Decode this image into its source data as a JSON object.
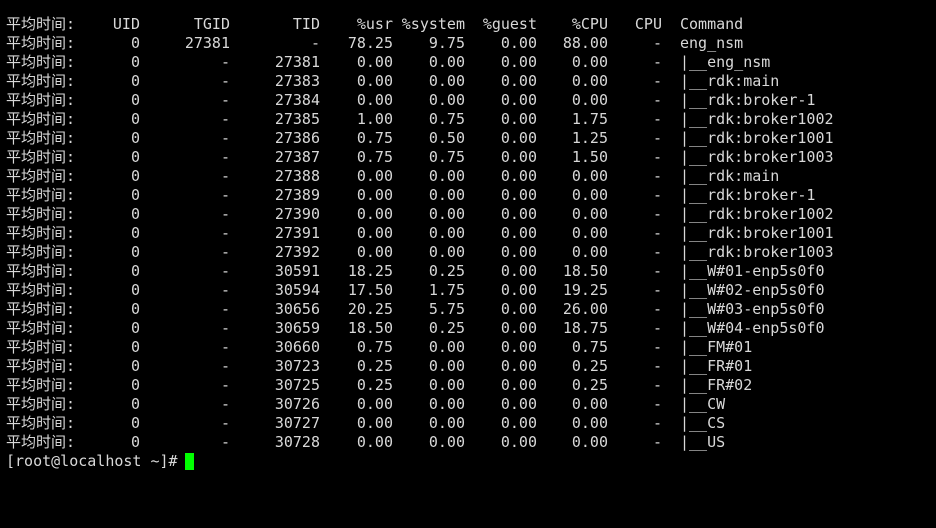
{
  "terminal": {
    "header": {
      "label": "平均时间:",
      "uid": "UID",
      "tgid": "TGID",
      "tid": "TID",
      "usr": "%usr",
      "system": "%system",
      "guest": "%guest",
      "cpu_pct": "%CPU",
      "cpu": "CPU",
      "command": "Command"
    },
    "rows": [
      {
        "label": "平均时间:",
        "uid": "0",
        "tgid": "27381",
        "tid": "-",
        "usr": "78.25",
        "system": "9.75",
        "guest": "0.00",
        "cpu_pct": "88.00",
        "cpu": "-",
        "command": "eng_nsm"
      },
      {
        "label": "平均时间:",
        "uid": "0",
        "tgid": "-",
        "tid": "27381",
        "usr": "0.00",
        "system": "0.00",
        "guest": "0.00",
        "cpu_pct": "0.00",
        "cpu": "-",
        "command": "|__eng_nsm"
      },
      {
        "label": "平均时间:",
        "uid": "0",
        "tgid": "-",
        "tid": "27383",
        "usr": "0.00",
        "system": "0.00",
        "guest": "0.00",
        "cpu_pct": "0.00",
        "cpu": "-",
        "command": "|__rdk:main"
      },
      {
        "label": "平均时间:",
        "uid": "0",
        "tgid": "-",
        "tid": "27384",
        "usr": "0.00",
        "system": "0.00",
        "guest": "0.00",
        "cpu_pct": "0.00",
        "cpu": "-",
        "command": "|__rdk:broker-1"
      },
      {
        "label": "平均时间:",
        "uid": "0",
        "tgid": "-",
        "tid": "27385",
        "usr": "1.00",
        "system": "0.75",
        "guest": "0.00",
        "cpu_pct": "1.75",
        "cpu": "-",
        "command": "|__rdk:broker1002"
      },
      {
        "label": "平均时间:",
        "uid": "0",
        "tgid": "-",
        "tid": "27386",
        "usr": "0.75",
        "system": "0.50",
        "guest": "0.00",
        "cpu_pct": "1.25",
        "cpu": "-",
        "command": "|__rdk:broker1001"
      },
      {
        "label": "平均时间:",
        "uid": "0",
        "tgid": "-",
        "tid": "27387",
        "usr": "0.75",
        "system": "0.75",
        "guest": "0.00",
        "cpu_pct": "1.50",
        "cpu": "-",
        "command": "|__rdk:broker1003"
      },
      {
        "label": "平均时间:",
        "uid": "0",
        "tgid": "-",
        "tid": "27388",
        "usr": "0.00",
        "system": "0.00",
        "guest": "0.00",
        "cpu_pct": "0.00",
        "cpu": "-",
        "command": "|__rdk:main"
      },
      {
        "label": "平均时间:",
        "uid": "0",
        "tgid": "-",
        "tid": "27389",
        "usr": "0.00",
        "system": "0.00",
        "guest": "0.00",
        "cpu_pct": "0.00",
        "cpu": "-",
        "command": "|__rdk:broker-1"
      },
      {
        "label": "平均时间:",
        "uid": "0",
        "tgid": "-",
        "tid": "27390",
        "usr": "0.00",
        "system": "0.00",
        "guest": "0.00",
        "cpu_pct": "0.00",
        "cpu": "-",
        "command": "|__rdk:broker1002"
      },
      {
        "label": "平均时间:",
        "uid": "0",
        "tgid": "-",
        "tid": "27391",
        "usr": "0.00",
        "system": "0.00",
        "guest": "0.00",
        "cpu_pct": "0.00",
        "cpu": "-",
        "command": "|__rdk:broker1001"
      },
      {
        "label": "平均时间:",
        "uid": "0",
        "tgid": "-",
        "tid": "27392",
        "usr": "0.00",
        "system": "0.00",
        "guest": "0.00",
        "cpu_pct": "0.00",
        "cpu": "-",
        "command": "|__rdk:broker1003"
      },
      {
        "label": "平均时间:",
        "uid": "0",
        "tgid": "-",
        "tid": "30591",
        "usr": "18.25",
        "system": "0.25",
        "guest": "0.00",
        "cpu_pct": "18.50",
        "cpu": "-",
        "command": "|__W#01-enp5s0f0"
      },
      {
        "label": "平均时间:",
        "uid": "0",
        "tgid": "-",
        "tid": "30594",
        "usr": "17.50",
        "system": "1.75",
        "guest": "0.00",
        "cpu_pct": "19.25",
        "cpu": "-",
        "command": "|__W#02-enp5s0f0"
      },
      {
        "label": "平均时间:",
        "uid": "0",
        "tgid": "-",
        "tid": "30656",
        "usr": "20.25",
        "system": "5.75",
        "guest": "0.00",
        "cpu_pct": "26.00",
        "cpu": "-",
        "command": "|__W#03-enp5s0f0"
      },
      {
        "label": "平均时间:",
        "uid": "0",
        "tgid": "-",
        "tid": "30659",
        "usr": "18.50",
        "system": "0.25",
        "guest": "0.00",
        "cpu_pct": "18.75",
        "cpu": "-",
        "command": "|__W#04-enp5s0f0"
      },
      {
        "label": "平均时间:",
        "uid": "0",
        "tgid": "-",
        "tid": "30660",
        "usr": "0.75",
        "system": "0.00",
        "guest": "0.00",
        "cpu_pct": "0.75",
        "cpu": "-",
        "command": "|__FM#01"
      },
      {
        "label": "平均时间:",
        "uid": "0",
        "tgid": "-",
        "tid": "30723",
        "usr": "0.25",
        "system": "0.00",
        "guest": "0.00",
        "cpu_pct": "0.25",
        "cpu": "-",
        "command": "|__FR#01"
      },
      {
        "label": "平均时间:",
        "uid": "0",
        "tgid": "-",
        "tid": "30725",
        "usr": "0.25",
        "system": "0.00",
        "guest": "0.00",
        "cpu_pct": "0.25",
        "cpu": "-",
        "command": "|__FR#02"
      },
      {
        "label": "平均时间:",
        "uid": "0",
        "tgid": "-",
        "tid": "30726",
        "usr": "0.00",
        "system": "0.00",
        "guest": "0.00",
        "cpu_pct": "0.00",
        "cpu": "-",
        "command": "|__CW"
      },
      {
        "label": "平均时间:",
        "uid": "0",
        "tgid": "-",
        "tid": "30727",
        "usr": "0.00",
        "system": "0.00",
        "guest": "0.00",
        "cpu_pct": "0.00",
        "cpu": "-",
        "command": "|__CS"
      },
      {
        "label": "平均时间:",
        "uid": "0",
        "tgid": "-",
        "tid": "30728",
        "usr": "0.00",
        "system": "0.00",
        "guest": "0.00",
        "cpu_pct": "0.00",
        "cpu": "-",
        "command": "|__US"
      }
    ],
    "prompt": "[root@localhost ~]#",
    "colors": {
      "background": "#000000",
      "text": "#d8d8d8",
      "cursor": "#00ff00"
    }
  }
}
